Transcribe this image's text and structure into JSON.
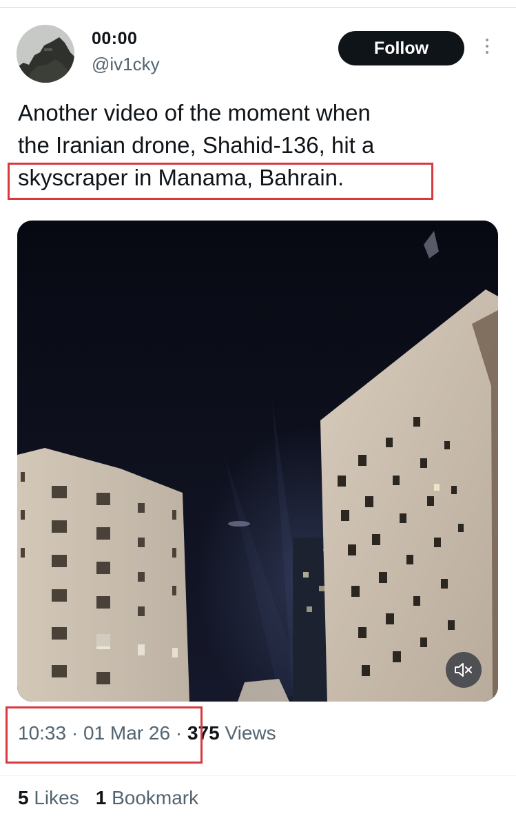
{
  "author": {
    "display_name": "00:00",
    "handle": "@iv1cky"
  },
  "actions": {
    "follow_label": "Follow"
  },
  "tweet": {
    "text_line_1": "Another video of the moment when",
    "text_line_2": "the Iranian drone, Shahid-136, hit a",
    "text_line_3": "skyscraper in Manama, Bahrain."
  },
  "media": {
    "type": "video",
    "mute_icon": "speaker-muted-icon"
  },
  "meta": {
    "time": "10:33",
    "separator": "·",
    "date": "01 Mar 26",
    "views_count": "375",
    "views_label": "Views"
  },
  "stats": {
    "likes_count": "5",
    "likes_label": "Likes",
    "bookmarks_count": "1",
    "bookmarks_label": "Bookmark"
  },
  "colors": {
    "highlight_border": "#d8393f",
    "follow_bg": "#0f1419",
    "secondary_text": "#536471"
  }
}
